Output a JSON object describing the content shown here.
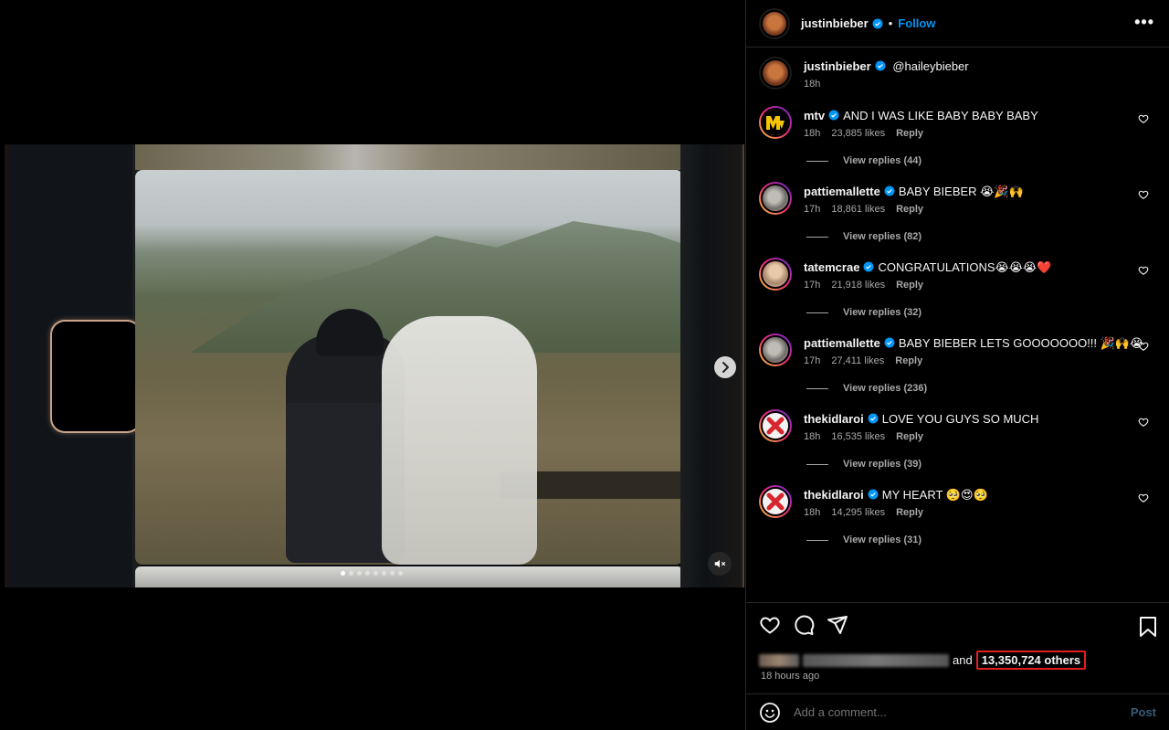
{
  "post": {
    "author": "justinbieber",
    "follow_label": "Follow",
    "separator": "•",
    "more_label": "•••",
    "caption_author": "justinbieber",
    "caption_text": "@haileybieber",
    "caption_time": "18h"
  },
  "carousel": {
    "slide_count": 8,
    "active_index": 0
  },
  "comments": [
    {
      "user": "mtv",
      "avatar": "mtv-logo",
      "text": "AND I WAS LIKE BABY BABY BABY",
      "time": "18h",
      "likes": "23,885 likes",
      "reply": "Reply",
      "view_replies": "View replies (44)"
    },
    {
      "user": "pattiemallette",
      "avatar": "pattie-photo",
      "text": "BABY BIEBER 😭🎉🙌",
      "time": "17h",
      "likes": "18,861 likes",
      "reply": "Reply",
      "view_replies": "View replies (82)"
    },
    {
      "user": "tatemcrae",
      "avatar": "tate-photo",
      "text": "CONGRATULATIONS😭😭😭❤️",
      "time": "17h",
      "likes": "21,918 likes",
      "reply": "Reply",
      "view_replies": "View replies (32)"
    },
    {
      "user": "pattiemallette",
      "avatar": "pattie-photo",
      "text": "BABY BIEBER LETS GOOOOOOO!!! 🎉🙌😭",
      "time": "17h",
      "likes": "27,411 likes",
      "reply": "Reply",
      "view_replies": "View replies (236)"
    },
    {
      "user": "thekidlaroi",
      "avatar": "x-logo",
      "text": "LOVE YOU GUYS SO MUCH",
      "time": "18h",
      "likes": "16,535 likes",
      "reply": "Reply",
      "view_replies": "View replies (39)"
    },
    {
      "user": "thekidlaroi",
      "avatar": "x-logo",
      "text": "MY HEART 🥺😍🥺",
      "time": "18h",
      "likes": "14,295 likes",
      "reply": "Reply",
      "view_replies": "View replies (31)"
    }
  ],
  "footer": {
    "likes_and": "and",
    "likes_others": "13,350,724 others",
    "posted": "18 hours ago",
    "comment_placeholder": "Add a comment...",
    "post_label": "Post"
  },
  "colors": {
    "link_blue": "#0095f6",
    "highlight_red": "#e02020"
  }
}
